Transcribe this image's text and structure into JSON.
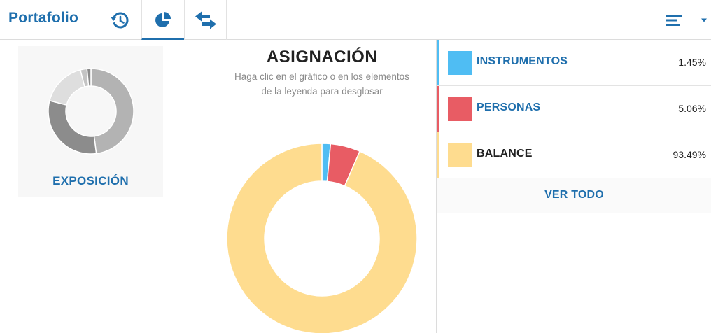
{
  "header": {
    "brand": "Portafolio",
    "tabs": [
      {
        "icon": "history-icon"
      },
      {
        "icon": "pie-chart-icon",
        "active": true
      },
      {
        "icon": "swap-arrows-icon"
      }
    ],
    "right_controls": [
      {
        "icon": "list-lines-icon"
      },
      {
        "icon": "caret-down-icon"
      }
    ]
  },
  "exposure_card": {
    "label": "EXPOSICIÓN",
    "segments": [
      {
        "value": 48,
        "color": "#b3b3b3"
      },
      {
        "value": 31,
        "color": "#8c8c8c"
      },
      {
        "value": 17,
        "color": "#dedede"
      },
      {
        "value": 2.5,
        "color": "#c4c4c4"
      },
      {
        "value": 1.5,
        "color": "#8a8a8a"
      }
    ]
  },
  "allocation": {
    "title": "ASIGNACIÓN",
    "subtitle_line1": "Haga clic en el gráfico o en los elementos",
    "subtitle_line2": "de la leyenda para desglosar"
  },
  "chart_data": {
    "type": "pie",
    "title": "ASIGNACIÓN",
    "categories": [
      "INSTRUMENTOS",
      "PERSONAS",
      "BALANCE"
    ],
    "values": [
      1.45,
      5.06,
      93.49
    ],
    "colors": [
      "#4fbdf3",
      "#e85c64",
      "#fedc8f"
    ],
    "legend": "right"
  },
  "legend": {
    "items": [
      {
        "name": "INSTRUMENTOS",
        "pct": "1.45%",
        "color": "#4fbdf3",
        "name_color": "#1f6fad"
      },
      {
        "name": "PERSONAS",
        "pct": "5.06%",
        "color": "#e85c64",
        "name_color": "#1f6fad"
      },
      {
        "name": "BALANCE",
        "pct": "93.49%",
        "color": "#fedc8f",
        "name_color": "#222222"
      }
    ],
    "view_all": "VER TODO"
  }
}
